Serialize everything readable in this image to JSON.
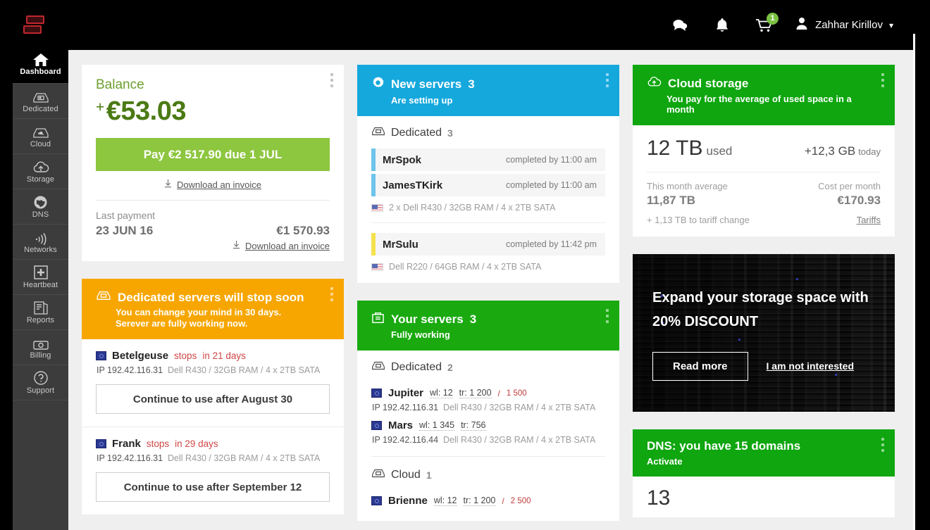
{
  "brand": {
    "logo_name": "servers-logo",
    "accent_green": "#8dc63f",
    "accent_blue": "#15a8dd",
    "accent_orange": "#f7a600"
  },
  "header": {
    "chat_icon": "chat-bubble-icon",
    "bell_icon": "bell-icon",
    "cart_icon": "cart-icon",
    "cart_badge": "1",
    "avatar_icon": "user-avatar-icon",
    "user_name": "Zahhar Kirillov",
    "caret": "∨"
  },
  "sidebar": {
    "items": [
      {
        "label": "Dashboard",
        "icon": "home-icon",
        "active": true
      },
      {
        "label": "Dedicated",
        "icon": "dedicated-server-icon",
        "active": false
      },
      {
        "label": "Cloud",
        "icon": "cloud-server-icon",
        "active": false
      },
      {
        "label": "Storage",
        "icon": "cloud-upload-icon",
        "active": false
      },
      {
        "label": "DNS",
        "icon": "globe-icon",
        "active": false
      },
      {
        "label": "Networks",
        "icon": "wifi-signal-icon",
        "active": false
      },
      {
        "label": "Heartbeat",
        "icon": "plus-square-icon",
        "active": false
      },
      {
        "label": "Reports",
        "icon": "reports-icon",
        "active": false
      },
      {
        "label": "Billing",
        "icon": "banknote-icon",
        "active": false
      },
      {
        "label": "Support",
        "icon": "question-circle-icon",
        "active": false
      }
    ]
  },
  "balance_card": {
    "title": "Balance",
    "plus": "+",
    "amount": "€53.03",
    "pay_button": "Pay €2 517.90 due 1 JUL",
    "download_invoice": "Download an invoice",
    "last_payment_label": "Last payment",
    "last_payment_date": "23 JUN 16",
    "last_payment_amount": "€1 570.93",
    "last_payment_invoice": "Download an invoice",
    "menu_icon": "kebab-menu-icon"
  },
  "stop_soon_card": {
    "icon": "dedicated-server-icon",
    "title": "Dedicated servers will stop soon",
    "sub_line1": "You can change your mind in 30 days.",
    "sub_line2": "Serever are fully working now.",
    "menu_icon": "kebab-menu-icon",
    "servers": [
      {
        "os_icon": "os-disk-icon",
        "name": "Betelgeuse",
        "stops": "stops",
        "in_days": "in 21 days",
        "ip_label": "IP 192.42.116.31",
        "spec": "Dell R430 / 32GB RAM / 4 x 2TB SATA",
        "button": "Continue to use after August 30"
      },
      {
        "os_icon": "os-disk-icon",
        "name": "Frank",
        "stops": "stops",
        "in_days": "in 29 days",
        "ip_label": "IP 192.42.116.31",
        "spec": "Dell R430 / 32GB RAM / 4 x 2TB SATA",
        "button": "Continue to use after September 12"
      }
    ]
  },
  "new_servers_card": {
    "icon": "gear-icon",
    "title": "New servers",
    "count": "3",
    "sub": "Are setting up",
    "menu_icon": "kebab-menu-icon",
    "section": {
      "icon": "dedicated-server-icon",
      "label": "Dedicated",
      "count": "3"
    },
    "group1": {
      "rows": [
        {
          "name": "MrSpok",
          "status": "completed by 11:00 am",
          "accent": "blue"
        },
        {
          "name": "JamesTKirk",
          "status": "completed by 11:00 am",
          "accent": "blue"
        }
      ],
      "flag_icon": "us-flag-icon",
      "spec": "2 x Dell R430 / 32GB RAM / 4 x 2TB SATA"
    },
    "group2": {
      "rows": [
        {
          "name": "MrSulu",
          "status": "completed by 11:42 pm",
          "accent": "yellow"
        }
      ],
      "flag_icon": "us-flag-icon",
      "spec": "Dell R220 / 64GB RAM / 4 x 2TB SATA"
    }
  },
  "your_servers_card": {
    "icon": "archive-box-icon",
    "title": "Your servers",
    "count": "3",
    "sub": "Fully working",
    "menu_icon": "kebab-menu-icon",
    "dedicated": {
      "icon": "dedicated-server-icon",
      "label": "Dedicated",
      "count": "2"
    },
    "dedicated_rows": [
      {
        "os_icon": "os-disk-icon",
        "name": "Jupiter",
        "wl": "wl: 12",
        "tr": "tr: 1 200",
        "sep": "/",
        "limit": "1 500",
        "ip_label": "IP 192.42.116.31",
        "spec": "Dell R430 / 32GB RAM / 4 x 2TB SATA"
      },
      {
        "os_icon": "os-disk-icon",
        "name": "Mars",
        "wl": "wl: 1 345",
        "tr": "tr: 756",
        "sep": "",
        "limit": "",
        "ip_label": "IP 192.42.116.44",
        "spec": "Dell R430 / 32GB RAM / 4 x 2TB SATA"
      }
    ],
    "cloud": {
      "icon": "dedicated-server-icon",
      "label": "Cloud",
      "count": "1"
    },
    "cloud_rows": [
      {
        "os_icon": "os-disk-icon",
        "name": "Brienne",
        "wl": "wl: 12",
        "tr": "tr: 1 200",
        "sep": "/",
        "limit": "2 500"
      }
    ]
  },
  "cloud_storage_card": {
    "icon": "cloud-upload-icon",
    "title": "Cloud storage",
    "sub": "You pay for the average of used space in a month",
    "menu_icon": "kebab-menu-icon",
    "used_value": "12 TB",
    "used_label": "used",
    "today_value": "+12,3 GB",
    "today_label": "today",
    "month_avg_label": "This month average",
    "month_avg_value": "11,87  TB",
    "cost_label": "Cost per month",
    "cost_value": "€170.93",
    "tariff_note": "+ 1,13 TB to tariff change",
    "tariffs_link": "Tariffs"
  },
  "promo_card": {
    "line1": "Expand your storage space with",
    "line2": "20% DISCOUNT",
    "read_more": "Read more",
    "not_interested": "I am not interested"
  },
  "dns_card": {
    "title": "DNS: you have 15 domains",
    "sub": "Activate",
    "menu_icon": "kebab-menu-icon",
    "value": "13"
  }
}
